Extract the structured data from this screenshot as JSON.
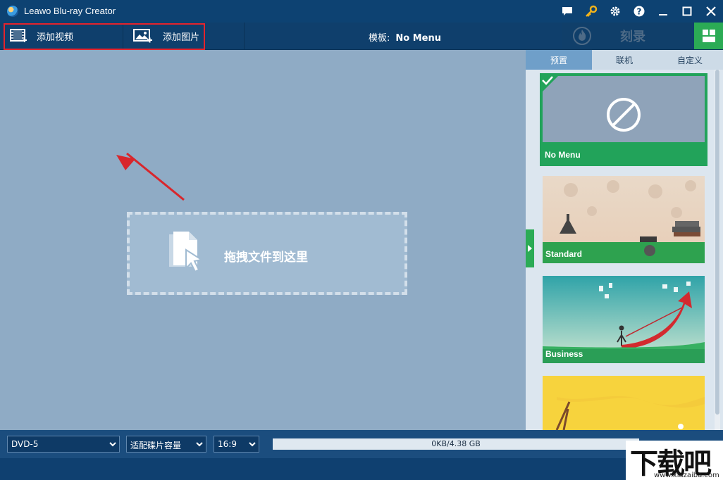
{
  "window": {
    "title": "Leawo Blu-ray Creator"
  },
  "titlebar_icons": [
    "chat-icon",
    "key-icon",
    "gear-icon",
    "help-icon",
    "minimize-icon",
    "maximize-icon",
    "close-icon"
  ],
  "toolbar": {
    "add_video": "添加视频",
    "add_image": "添加图片",
    "template_label": "模板:",
    "template_value": "No Menu",
    "burn": "刻录"
  },
  "dropzone": {
    "text": "拖拽文件到这里"
  },
  "panel": {
    "tabs": [
      {
        "label": "预置",
        "active": true
      },
      {
        "label": "联机",
        "active": false
      },
      {
        "label": "自定义",
        "active": false
      }
    ],
    "templates": [
      {
        "name": "No Menu",
        "selected": true
      },
      {
        "name": "Standard",
        "selected": false
      },
      {
        "name": "Business",
        "selected": false
      },
      {
        "name": "",
        "selected": false
      }
    ]
  },
  "bottom": {
    "disc_type": "DVD-5",
    "quality": "适配碟片容量",
    "aspect": "16:9",
    "capacity": "0KB/4.38 GB"
  },
  "watermark": {
    "big": "下载吧",
    "small": "www.xiazaiba.com"
  },
  "colors": {
    "accent_green": "#2bab55",
    "titlebar": "#0d4272",
    "canvas": "#8fabc5",
    "highlight_red": "#e5232c"
  }
}
